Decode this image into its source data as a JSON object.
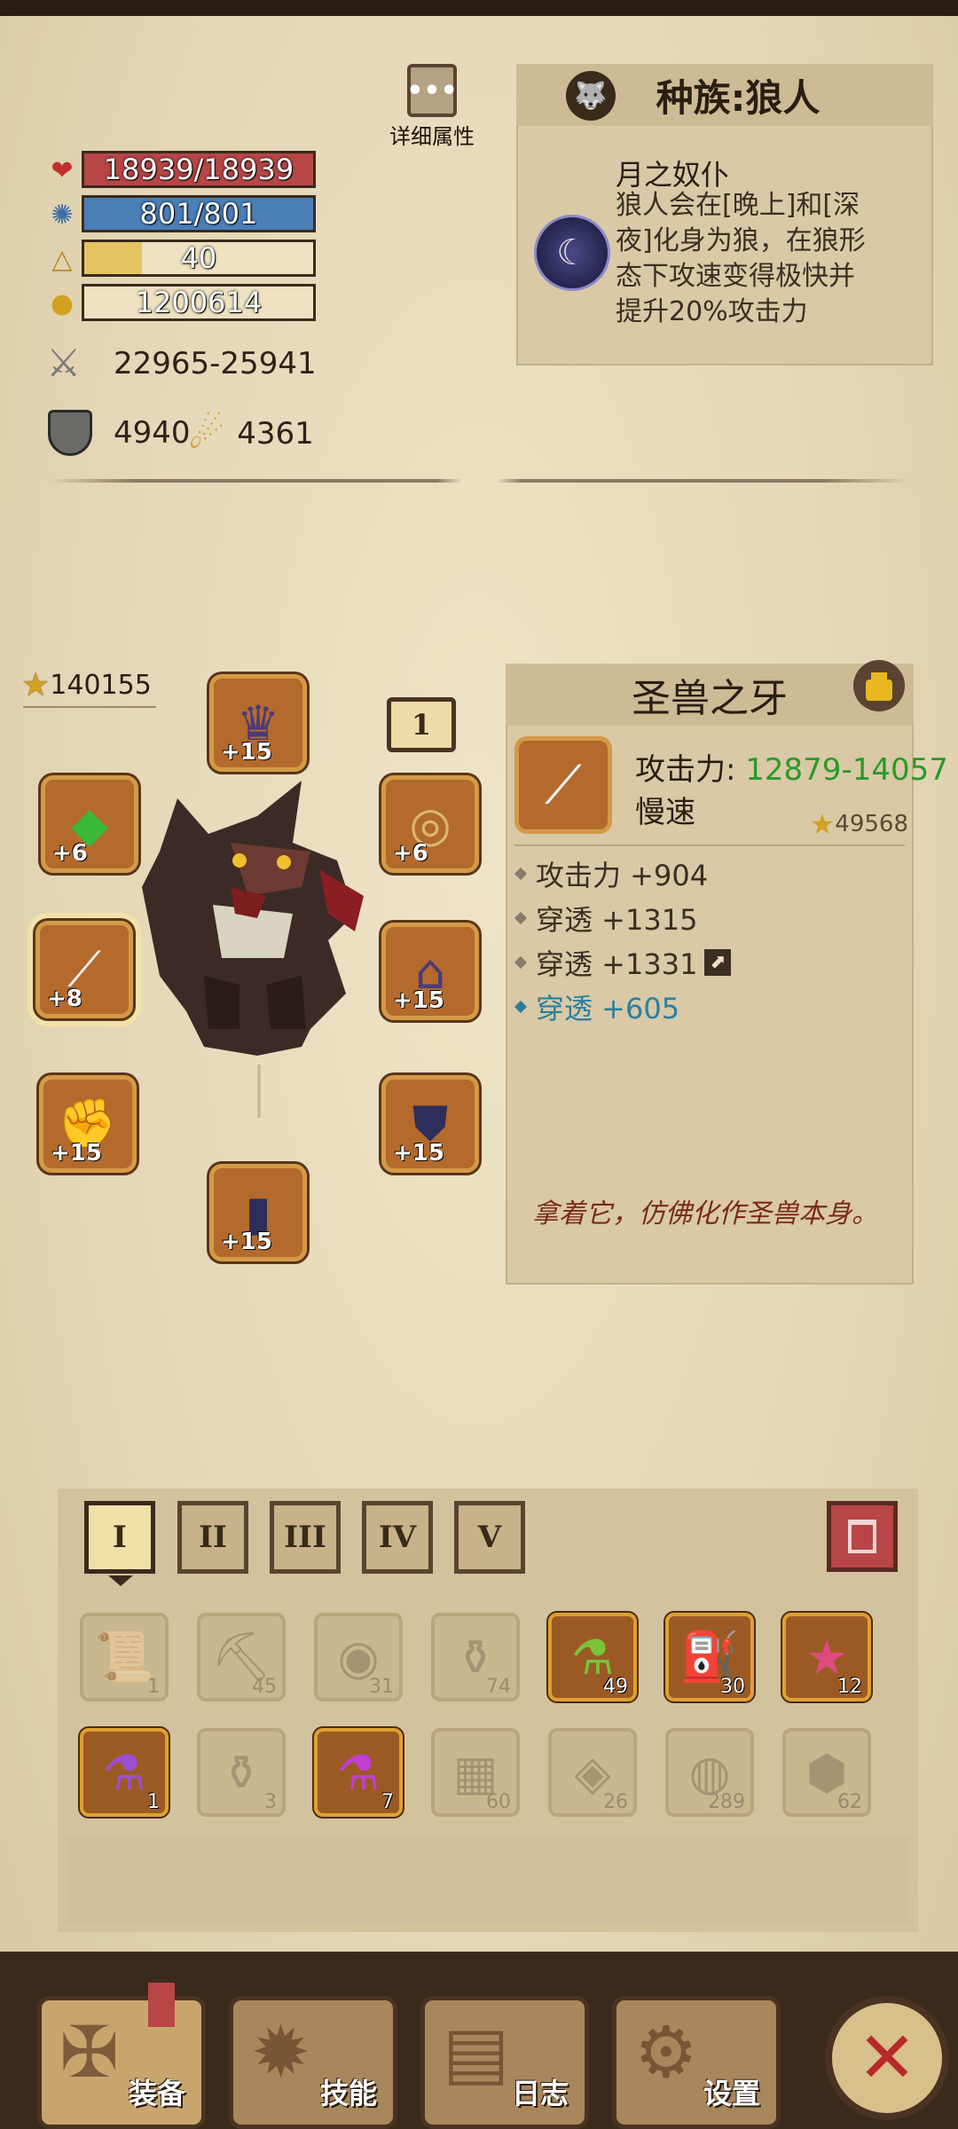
{
  "detail_button": {
    "label": "详细属性",
    "icon": "ellipsis-icon"
  },
  "stats": {
    "hp": {
      "text": "18939/18939",
      "fraction": 1.0,
      "color": "#b23a3a",
      "icon": "heart-icon"
    },
    "mp": {
      "text": "801/801",
      "fraction": 1.0,
      "color": "#3c6fa8",
      "icon": "mana-icon"
    },
    "level": {
      "text": "40",
      "fraction": 0.25,
      "color": "#e0c060",
      "icon": "level-icon"
    },
    "gold": {
      "text": "1200614",
      "icon": "gold-icon"
    },
    "attack": {
      "text": "22965-25941",
      "icon": "crossed-swords-icon"
    },
    "defense": {
      "text": "4940",
      "icon": "shield-icon"
    },
    "magic_defense": {
      "text": "4361",
      "icon": "staff-icon"
    }
  },
  "race": {
    "title": "种族:狼人",
    "skill_name": "月之奴仆",
    "description_lines": [
      "狼人会在[晚上]和[深",
      "夜]化身为狼，在狼形",
      "态下攻速变得极快并",
      "提升20%攻击力"
    ]
  },
  "character": {
    "power": "140155",
    "badge": "1",
    "slots": [
      {
        "name": "helmet",
        "level": "+15",
        "icon": "crown-icon"
      },
      {
        "name": "left-accessory",
        "level": "+6",
        "icon": "emerald-bracer-icon"
      },
      {
        "name": "right-accessory",
        "level": "+6",
        "icon": "amulet-icon"
      },
      {
        "name": "weapon",
        "level": "+8",
        "icon": "fang-blade-icon"
      },
      {
        "name": "shoulders",
        "level": "+15",
        "icon": "pauldron-icon"
      },
      {
        "name": "gloves",
        "level": "+15",
        "icon": "gauntlet-icon"
      },
      {
        "name": "armor",
        "level": "+15",
        "icon": "chestplate-icon"
      },
      {
        "name": "boots",
        "level": "+15",
        "icon": "greaves-icon"
      }
    ]
  },
  "item": {
    "name": "圣兽之牙",
    "attack_label": "攻击力:",
    "attack_value": "12879-14057",
    "speed": "慢速",
    "score": "49568",
    "affixes": [
      {
        "text": "攻击力 +904",
        "color": "#3b2f22"
      },
      {
        "text": "穿透 +1315",
        "color": "#3b2f22"
      },
      {
        "text": "穿透 +1331",
        "color": "#3b2f22"
      },
      {
        "text": "穿透 +605",
        "color": "#2a7fa0"
      }
    ],
    "flavor": "拿着它，仿佛化作圣兽本身。"
  },
  "inventory": {
    "tabs": [
      "I",
      "II",
      "III",
      "IV",
      "V"
    ],
    "active_tab": 0,
    "items": [
      {
        "count": "1",
        "icon": "scroll-icon",
        "owned": false
      },
      {
        "count": "45",
        "icon": "pickaxe-icon",
        "owned": false
      },
      {
        "count": "31",
        "icon": "eye-scroll-icon",
        "owned": false
      },
      {
        "count": "74",
        "icon": "potion-icon",
        "owned": false
      },
      {
        "count": "49",
        "icon": "green-potion-icon",
        "owned": true
      },
      {
        "count": "30",
        "icon": "gold-flask-icon",
        "owned": true
      },
      {
        "count": "12",
        "icon": "star-potion-icon",
        "owned": true
      },
      {
        "count": "1",
        "icon": "purple-potion-icon",
        "owned": true
      },
      {
        "count": "3",
        "icon": "flask-icon",
        "owned": false
      },
      {
        "count": "7",
        "icon": "magic-potion-icon",
        "owned": true
      },
      {
        "count": "60",
        "icon": "stone-icon",
        "owned": false
      },
      {
        "count": "26",
        "icon": "ore-icon",
        "owned": false
      },
      {
        "count": "289",
        "icon": "meat-icon",
        "owned": false
      },
      {
        "count": "62",
        "icon": "rock-icon",
        "owned": false
      }
    ]
  },
  "nav": {
    "equip": "装备",
    "skills": "技能",
    "log": "日志",
    "settings": "设置"
  },
  "colors": {
    "attack_green": "#2a9a2a",
    "affix_blue": "#2a7fa0",
    "flavor_red": "#7a2a1a"
  }
}
